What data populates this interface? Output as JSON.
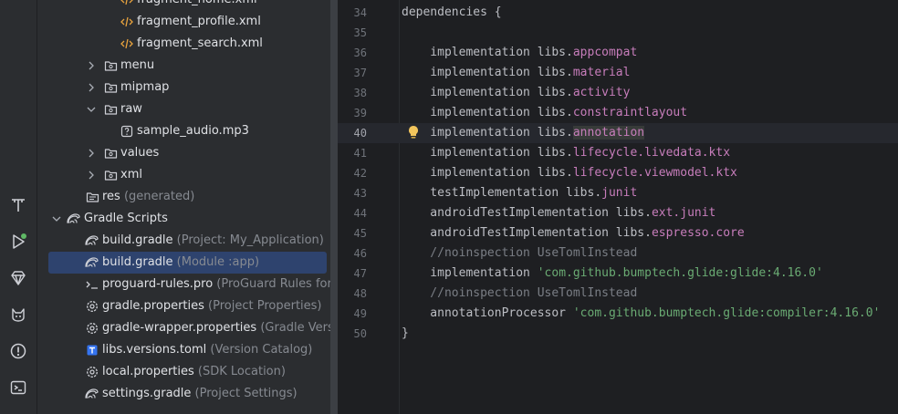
{
  "toolstrip": {
    "icons": [
      "text-tool-icon",
      "run-icon",
      "gem-icon",
      "cat-icon",
      "problems-icon",
      "terminal-icon"
    ],
    "run_badge_color": "#5fb865"
  },
  "tree": {
    "rows": [
      {
        "label": "fragment_home.xml",
        "hint": "",
        "icon": "xml-icon",
        "arrow": ""
      },
      {
        "label": "fragment_profile.xml",
        "hint": "",
        "icon": "xml-icon",
        "arrow": ""
      },
      {
        "label": "fragment_search.xml",
        "hint": "",
        "icon": "xml-icon",
        "arrow": ""
      },
      {
        "label": "menu",
        "hint": "",
        "icon": "folder-icon",
        "arrow": "collapsed"
      },
      {
        "label": "mipmap",
        "hint": "",
        "icon": "folder-icon",
        "arrow": "collapsed"
      },
      {
        "label": "raw",
        "hint": "",
        "icon": "folder-icon",
        "arrow": "expanded"
      },
      {
        "label": "sample_audio.mp3",
        "hint": "",
        "icon": "unknown-file-icon",
        "arrow": ""
      },
      {
        "label": "values",
        "hint": "",
        "icon": "folder-icon",
        "arrow": "collapsed"
      },
      {
        "label": "xml",
        "hint": "",
        "icon": "folder-icon",
        "arrow": "collapsed"
      },
      {
        "label": "res",
        "hint": "(generated)",
        "icon": "res-folder-icon",
        "arrow": ""
      },
      {
        "label": "Gradle Scripts",
        "hint": "",
        "icon": "gradle-icon",
        "arrow": "expanded"
      },
      {
        "label": "build.gradle",
        "hint": "(Project: My_Application)",
        "icon": "gradle-icon",
        "arrow": ""
      },
      {
        "label": "build.gradle",
        "hint": "(Module :app)",
        "icon": "gradle-icon",
        "arrow": "",
        "selected": true
      },
      {
        "label": "proguard-rules.pro",
        "hint": "(ProGuard Rules for \"",
        "icon": "file-icon",
        "arrow": ""
      },
      {
        "label": "gradle.properties",
        "hint": "(Project Properties)",
        "icon": "settings-icon",
        "arrow": ""
      },
      {
        "label": "gradle-wrapper.properties",
        "hint": "(Gradle Versio",
        "icon": "settings-icon",
        "arrow": ""
      },
      {
        "label": "libs.versions.toml",
        "hint": "(Version Catalog)",
        "icon": "toml-icon",
        "arrow": ""
      },
      {
        "label": "local.properties",
        "hint": "(SDK Location)",
        "icon": "settings-icon",
        "arrow": ""
      },
      {
        "label": "settings.gradle",
        "hint": "(Project Settings)",
        "icon": "gradle-icon",
        "arrow": ""
      }
    ]
  },
  "editor": {
    "active_line": "40",
    "lines": [
      {
        "n": "34",
        "parts": [
          [
            "t",
            "dependencies {"
          ]
        ]
      },
      {
        "n": "35",
        "parts": []
      },
      {
        "n": "36",
        "parts": [
          [
            "t",
            "    implementation libs."
          ],
          [
            "p",
            "appcompat"
          ]
        ]
      },
      {
        "n": "37",
        "parts": [
          [
            "t",
            "    implementation libs."
          ],
          [
            "p",
            "material"
          ]
        ]
      },
      {
        "n": "38",
        "parts": [
          [
            "t",
            "    implementation libs."
          ],
          [
            "p",
            "activity"
          ]
        ]
      },
      {
        "n": "39",
        "parts": [
          [
            "t",
            "    implementation libs."
          ],
          [
            "p",
            "constraintlayout"
          ]
        ]
      },
      {
        "n": "40",
        "parts": [
          [
            "t",
            "    implementation libs."
          ],
          [
            "ph",
            "annotation"
          ]
        ]
      },
      {
        "n": "41",
        "parts": [
          [
            "t",
            "    implementation libs."
          ],
          [
            "p",
            "lifecycle.livedata.ktx"
          ]
        ]
      },
      {
        "n": "42",
        "parts": [
          [
            "t",
            "    implementation libs."
          ],
          [
            "p",
            "lifecycle.viewmodel.ktx"
          ]
        ]
      },
      {
        "n": "43",
        "parts": [
          [
            "t",
            "    testImplementation libs."
          ],
          [
            "p",
            "junit"
          ]
        ]
      },
      {
        "n": "44",
        "parts": [
          [
            "t",
            "    androidTestImplementation libs."
          ],
          [
            "p",
            "ext.junit"
          ]
        ]
      },
      {
        "n": "45",
        "parts": [
          [
            "t",
            "    androidTestImplementation libs."
          ],
          [
            "p",
            "espresso.core"
          ]
        ]
      },
      {
        "n": "46",
        "parts": [
          [
            "c",
            "    //noinspection UseTomlInstead"
          ]
        ]
      },
      {
        "n": "47",
        "parts": [
          [
            "t",
            "    implementation "
          ],
          [
            "s",
            "'com.github.bumptech.glide:glide:4.16.0'"
          ]
        ]
      },
      {
        "n": "48",
        "parts": [
          [
            "c",
            "    //noinspection UseTomlInstead"
          ]
        ]
      },
      {
        "n": "49",
        "parts": [
          [
            "t",
            "    annotationProcessor "
          ],
          [
            "s",
            "'com.github.bumptech.glide:compiler:4.16.0'"
          ]
        ]
      },
      {
        "n": "50",
        "parts": [
          [
            "t",
            "}"
          ]
        ]
      }
    ]
  }
}
